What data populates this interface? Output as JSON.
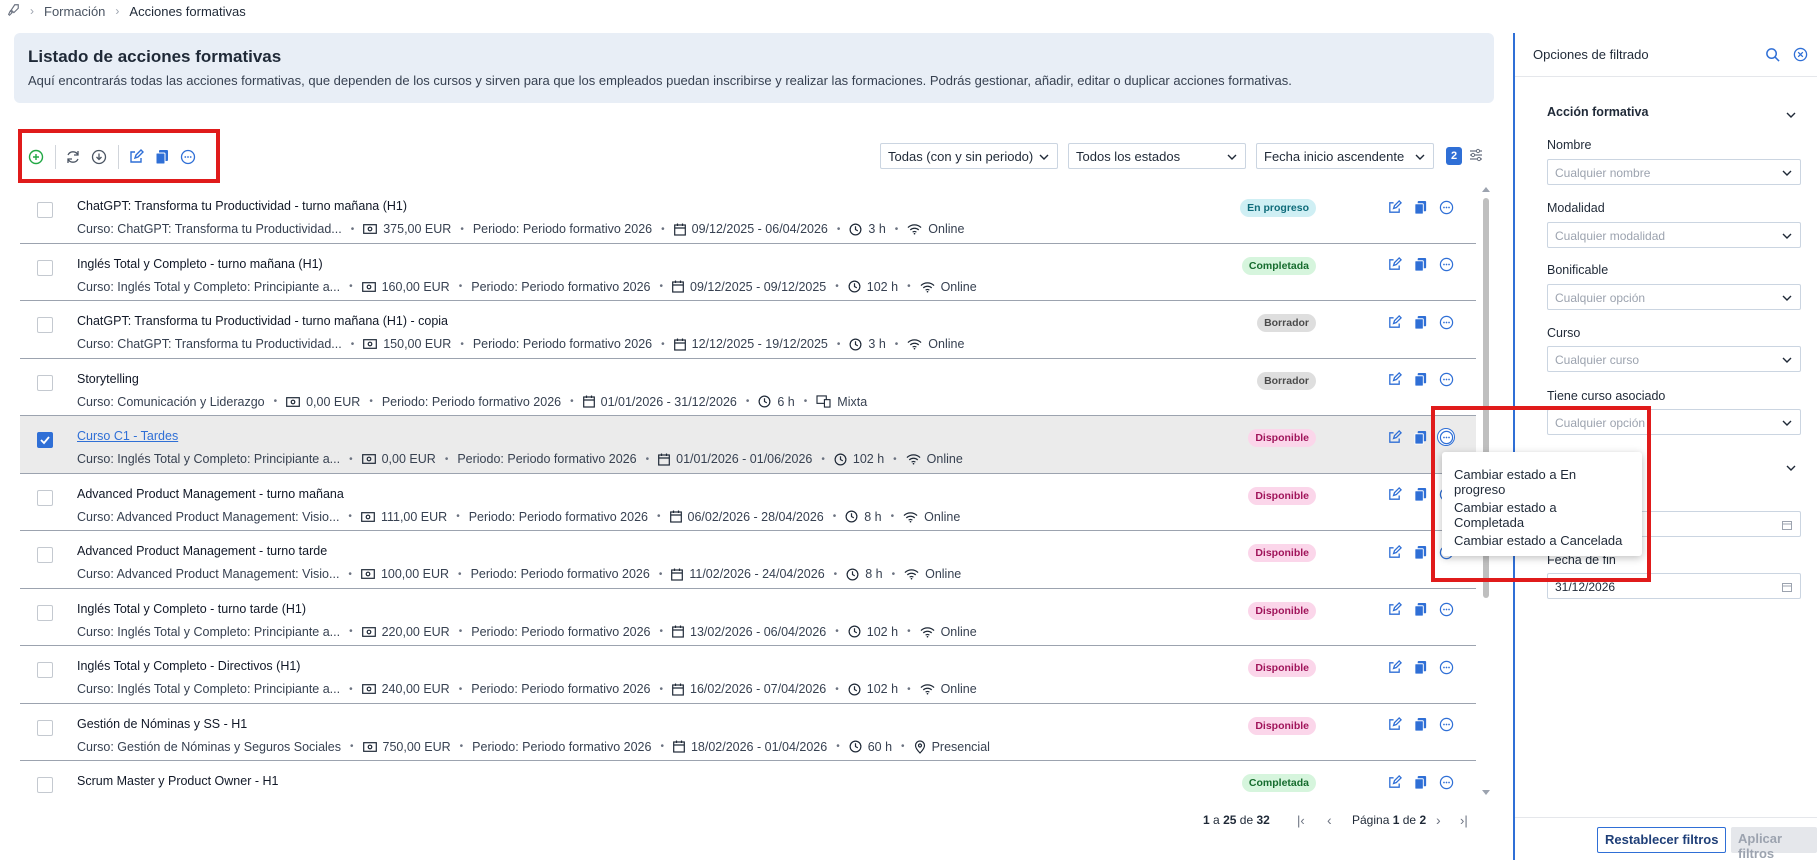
{
  "breadcrumb": {
    "root_icon": "rocket-icon",
    "items": [
      "Formación",
      "Acciones formativas"
    ]
  },
  "header": {
    "title": "Listado de acciones formativas",
    "description": "Aquí encontrarás todas las acciones formativas, que dependen de los cursos y sirven para que los empleados puedan inscribirse y realizar las formaciones. Podrás gestionar, añadir, editar o duplicar acciones formativas."
  },
  "filters": {
    "period": "Todas (con y sin periodo)",
    "status": "Todos los estados",
    "sort": "Fecha inicio ascendente",
    "active_count": "2"
  },
  "rows": [
    {
      "title": "ChatGPT: Transforma tu Productividad - turno mañana (H1)",
      "course": "Curso: ChatGPT: Transforma tu Productividad...",
      "price": "375,00 EUR",
      "period": "Periodo: Periodo formativo 2026",
      "dates": "09/12/2025 - 06/04/2026",
      "hours": "3 h",
      "mode": "Online",
      "mode_icon": "wifi-icon",
      "status": "En progreso",
      "status_kind": "prog"
    },
    {
      "title": "Inglés Total y Completo - turno mañana (H1)",
      "course": "Curso: Inglés Total y Completo: Principiante a...",
      "price": "160,00 EUR",
      "period": "Periodo: Periodo formativo 2026",
      "dates": "09/12/2025 - 09/12/2025",
      "hours": "102 h",
      "mode": "Online",
      "mode_icon": "wifi-icon",
      "status": "Completada",
      "status_kind": "comp"
    },
    {
      "title": "ChatGPT: Transforma tu Productividad - turno mañana (H1) - copia",
      "course": "Curso: ChatGPT: Transforma tu Productividad...",
      "price": "150,00 EUR",
      "period": "Periodo: Periodo formativo 2026",
      "dates": "12/12/2025 - 19/12/2025",
      "hours": "3 h",
      "mode": "Online",
      "mode_icon": "wifi-icon",
      "status": "Borrador",
      "status_kind": "borr"
    },
    {
      "title": "Storytelling",
      "course": "Curso: Comunicación y Liderazgo",
      "price": "0,00 EUR",
      "period": "Periodo: Periodo formativo 2026",
      "dates": "01/01/2026 - 31/12/2026",
      "hours": "6 h",
      "mode": "Mixta",
      "mode_icon": "mixed-icon",
      "status": "Borrador",
      "status_kind": "borr"
    },
    {
      "title": "Curso C1 - Tardes",
      "course": "Curso: Inglés Total y Completo: Principiante a...",
      "price": "0,00 EUR",
      "period": "Periodo: Periodo formativo 2026",
      "dates": "01/01/2026 - 01/06/2026",
      "hours": "102 h",
      "mode": "Online",
      "mode_icon": "wifi-icon",
      "status": "Disponible",
      "status_kind": "disp",
      "selected": true
    },
    {
      "title": "Advanced Product Management - turno mañana",
      "course": "Curso: Advanced Product Management: Visio...",
      "price": "111,00 EUR",
      "period": "Periodo: Periodo formativo 2026",
      "dates": "06/02/2026 - 28/04/2026",
      "hours": "8 h",
      "mode": "Online",
      "mode_icon": "wifi-icon",
      "status": "Disponible",
      "status_kind": "disp"
    },
    {
      "title": "Advanced Product Management - turno tarde",
      "course": "Curso: Advanced Product Management: Visio...",
      "price": "100,00 EUR",
      "period": "Periodo: Periodo formativo 2026",
      "dates": "11/02/2026 - 24/04/2026",
      "hours": "8 h",
      "mode": "Online",
      "mode_icon": "wifi-icon",
      "status": "Disponible",
      "status_kind": "disp"
    },
    {
      "title": "Inglés Total y Completo - turno tarde (H1)",
      "course": "Curso: Inglés Total y Completo: Principiante a...",
      "price": "220,00 EUR",
      "period": "Periodo: Periodo formativo 2026",
      "dates": "13/02/2026 - 06/04/2026",
      "hours": "102 h",
      "mode": "Online",
      "mode_icon": "wifi-icon",
      "status": "Disponible",
      "status_kind": "disp"
    },
    {
      "title": "Inglés Total y Completo - Directivos (H1)",
      "course": "Curso: Inglés Total y Completo: Principiante a...",
      "price": "240,00 EUR",
      "period": "Periodo: Periodo formativo 2026",
      "dates": "16/02/2026 - 07/04/2026",
      "hours": "102 h",
      "mode": "Online",
      "mode_icon": "wifi-icon",
      "status": "Disponible",
      "status_kind": "disp"
    },
    {
      "title": "Gestión de Nóminas y SS - H1",
      "course": "Curso: Gestión de Nóminas y Seguros Sociales",
      "price": "750,00 EUR",
      "period": "Periodo: Periodo formativo 2026",
      "dates": "18/02/2026 - 01/04/2026",
      "hours": "60 h",
      "mode": "Presencial",
      "mode_icon": "location-pin-icon",
      "status": "Disponible",
      "status_kind": "disp"
    },
    {
      "title": "Scrum Master y Product Owner - H1",
      "course": "",
      "price": "",
      "period": "",
      "dates": "",
      "hours": "",
      "mode": "",
      "mode_icon": "",
      "status": "Completada",
      "status_kind": "comp"
    }
  ],
  "context_menu": {
    "items": [
      "Cambiar estado a En progreso",
      "Cambiar estado a Completada",
      "Cambiar estado a Cancelada"
    ]
  },
  "pagination": {
    "range_start": "1",
    "range_a": "a",
    "range_end": "25",
    "range_de": "de",
    "total": "32",
    "page_label": "Página",
    "page": "1",
    "page_de": "de",
    "pages": "2"
  },
  "filter_panel": {
    "title": "Opciones de filtrado",
    "section": "Acción formativa",
    "fields": [
      {
        "label": "Nombre",
        "placeholder": "Cualquier nombre"
      },
      {
        "label": "Modalidad",
        "placeholder": "Cualquier modalidad"
      },
      {
        "label": "Bonificable",
        "placeholder": "Cualquier opción"
      },
      {
        "label": "Curso",
        "placeholder": "Cualquier curso"
      },
      {
        "label": "Tiene curso asociado",
        "placeholder": "Cualquier opción"
      }
    ],
    "end_date_label": "Fecha de fin",
    "end_date_value": "31/12/2026",
    "reset_button": "Restablecer filtros",
    "apply_button": "Aplicar filtros"
  },
  "colors": {
    "accent": "#2f6fd6",
    "highlight": "#e01b1b",
    "add": "#22a845"
  }
}
